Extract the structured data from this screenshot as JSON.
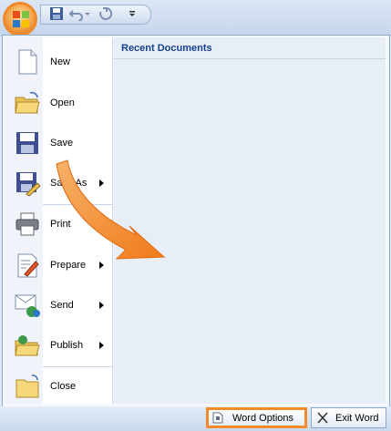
{
  "menu": {
    "items": [
      {
        "label": "New",
        "has_submenu": false,
        "icon": "new-document-icon"
      },
      {
        "label": "Open",
        "has_submenu": false,
        "icon": "open-folder-icon"
      },
      {
        "label": "Save",
        "has_submenu": false,
        "icon": "save-disk-icon"
      },
      {
        "label": "Save As",
        "has_submenu": true,
        "icon": "save-as-icon"
      },
      {
        "label": "Print",
        "has_submenu": true,
        "icon": "printer-icon"
      },
      {
        "label": "Prepare",
        "has_submenu": true,
        "icon": "prepare-icon"
      },
      {
        "label": "Send",
        "has_submenu": true,
        "icon": "send-icon"
      },
      {
        "label": "Publish",
        "has_submenu": true,
        "icon": "publish-icon"
      },
      {
        "label": "Close",
        "has_submenu": false,
        "icon": "close-folder-icon"
      }
    ],
    "recent_title": "Recent Documents"
  },
  "bottom": {
    "word_options_label": "Word Options",
    "exit_word_label": "Exit Word"
  },
  "colors": {
    "highlight": "#f08a2a",
    "title_text": "#15428b",
    "panel_border": "#8aa7cf"
  }
}
